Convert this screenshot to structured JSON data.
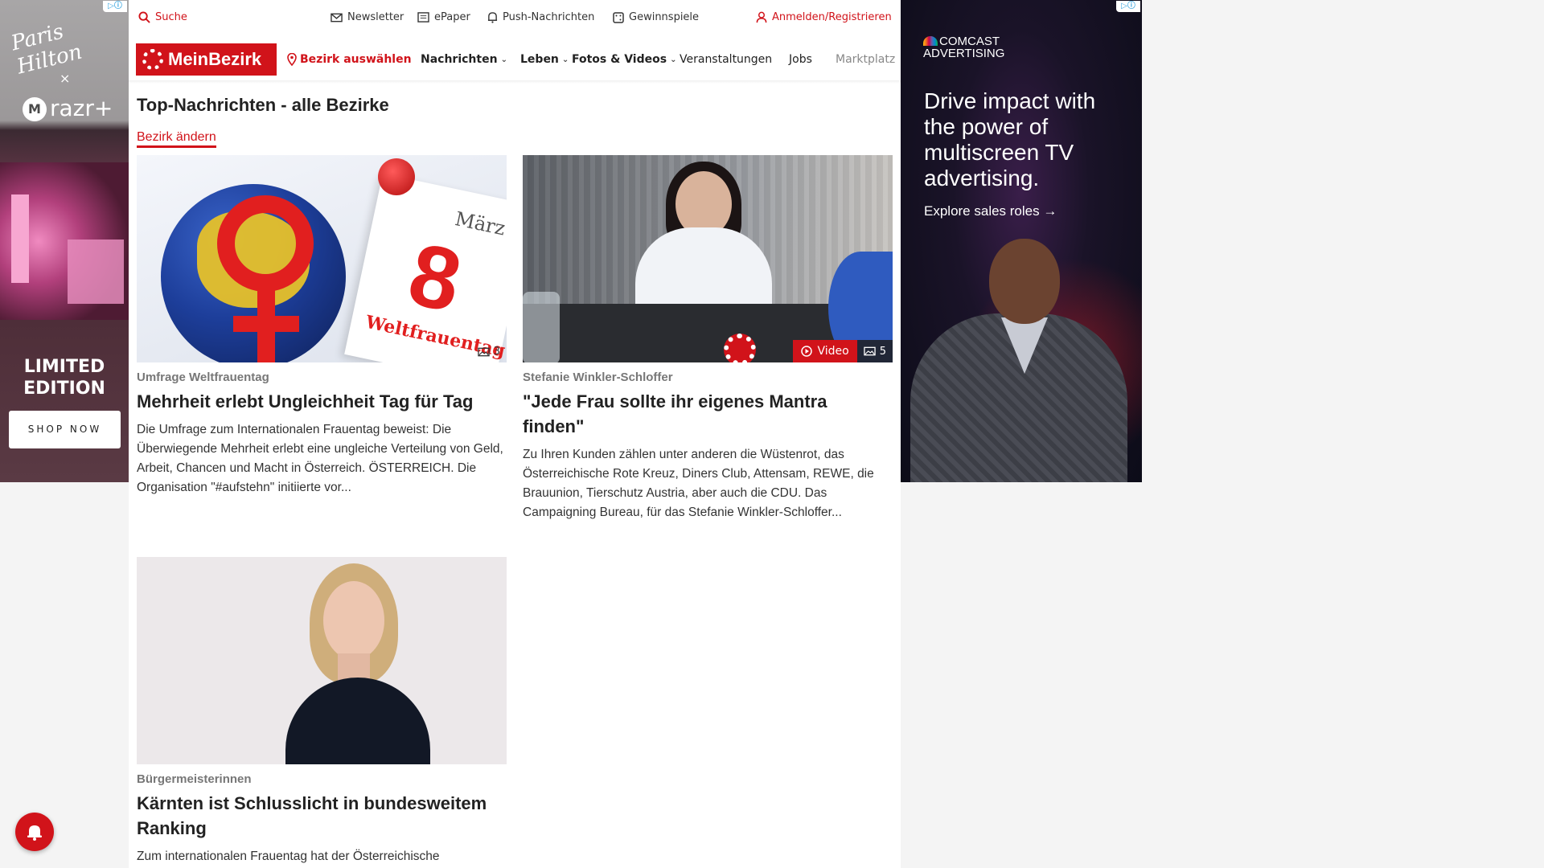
{
  "left_ad": {
    "brand_script": "Paris Hilton",
    "times": "×",
    "partner": "razr+",
    "moto_mark": "M",
    "edition": "LIMITED EDITION",
    "cta": "SHOP NOW",
    "info_icon": "adchoices-icon"
  },
  "utility_bar": {
    "search": "Suche",
    "newsletter": "Newsletter",
    "epaper": "ePaper",
    "push": "Push-Nachrichten",
    "games": "Gewinnspiele",
    "login": "Anmelden/Registrieren"
  },
  "nav": {
    "logo": "MeinBezirk",
    "district": "Bezirk auswählen",
    "items": [
      {
        "label": "Nachrichten",
        "dropdown": true
      },
      {
        "label": "Leben",
        "dropdown": true
      },
      {
        "label": "Fotos & Videos",
        "dropdown": true
      },
      {
        "label": "Veranstaltungen",
        "dropdown": false
      },
      {
        "label": "Jobs",
        "dropdown": false
      },
      {
        "label": "Marktplatz",
        "dropdown": false
      }
    ]
  },
  "page": {
    "title": "Top-Nachrichten - alle Bezirke",
    "change_district": "Bezirk ändern"
  },
  "articles": [
    {
      "kicker": "Umfrage Weltfrauentag",
      "headline": "Mehrheit erlebt Ungleichheit Tag für Tag",
      "teaser": "Die Umfrage zum Internationalen Frauentag beweist: Die Überwiegende Mehrheit erlebt eine ungleiche Verteilung von Geld, Arbeit, Chancen und Macht in Österreich. ÖSTERREICH. Die Organisation \"#aufstehn\" initiierte vor...",
      "photo_count": "3",
      "image_text": {
        "month": "März",
        "day": "8",
        "label": "Weltfrauentag"
      }
    },
    {
      "kicker": "Stefanie Winkler-Schloffer",
      "headline": "\"Jede Frau sollte ihr eigenes Mantra finden\"",
      "teaser": "Zu Ihren Kunden zählen unter anderen die Wüstenrot, das Österreichische Rote Kreuz, Diners Club, Attensam, REWE, die Brauunion, Tierschutz Austria, aber auch die CDU. Das Campaigning Bureau, für das Stefanie Winkler-Schloffer...",
      "video_label": "Video",
      "photo_count": "5"
    },
    {
      "kicker": "Bürgermeisterinnen",
      "headline": "Kärnten ist Schlusslicht in bundesweitem Ranking",
      "teaser": "Zum internationalen Frauentag hat der Österreichische"
    }
  ],
  "right_ad": {
    "brand_line1": "COMCAST",
    "brand_line2": "ADVERTISING",
    "headline": "Drive impact with the power of multiscreen TV advertising.",
    "cta": "Explore sales roles →"
  },
  "colors": {
    "brand_red": "#d1131a",
    "text": "#222222",
    "kicker_gray": "#777777"
  }
}
